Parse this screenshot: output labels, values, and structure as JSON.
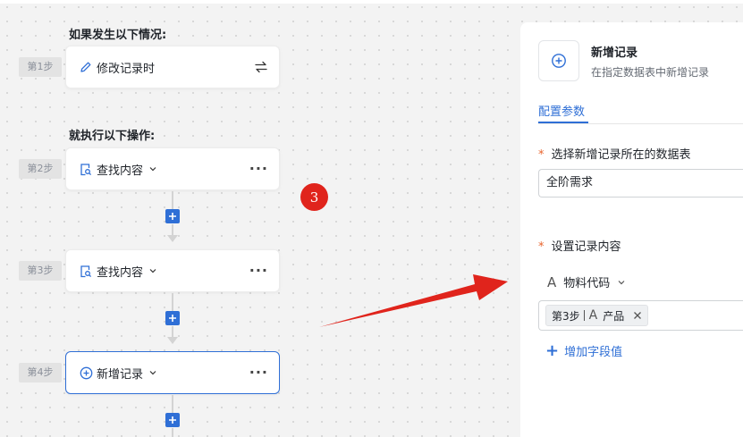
{
  "flow": {
    "trigger_heading": "如果发生以下情况:",
    "action_heading": "就执行以下操作:",
    "steps": [
      {
        "tag": "第1步",
        "label": "修改记录时"
      },
      {
        "tag": "第2步",
        "label": "查找内容"
      },
      {
        "tag": "第3步",
        "label": "查找内容"
      },
      {
        "tag": "第4步",
        "label": "新增记录"
      }
    ]
  },
  "annotation": {
    "badge": "3"
  },
  "panel": {
    "title": "新增记录",
    "subtitle": "在指定数据表中新增记录",
    "tab": "配置参数",
    "table_field": {
      "required": "*",
      "label": "选择新增记录所在的数据表",
      "value": "全阶需求"
    },
    "content_field": {
      "required": "*",
      "label": "设置记录内容"
    },
    "field_name": "物料代码",
    "chip": {
      "step": "第3步",
      "icon": "A",
      "name": "产品"
    },
    "add_field": "增加字段值"
  },
  "icons": {
    "edit": "pencil-icon",
    "swap": "swap-icon",
    "find": "find-doc-icon",
    "add": "plus-circle-icon",
    "more": "more-icon",
    "chevron": "chevron-down-icon",
    "close": "close-icon"
  },
  "colors": {
    "accent": "#2f6fd6",
    "badge": "#e0241c",
    "arrow": "#e0241c",
    "required": "#e8642d"
  }
}
